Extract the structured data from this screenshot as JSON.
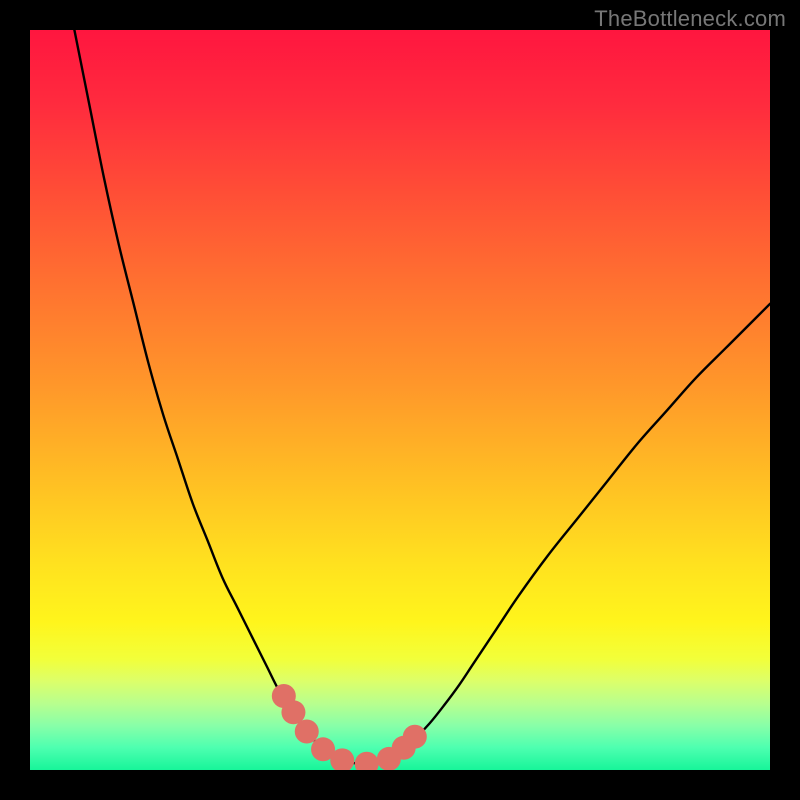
{
  "watermark": "TheBottleneck.com",
  "chart_data": {
    "type": "line",
    "title": "",
    "xlabel": "",
    "ylabel": "",
    "xlim": [
      0,
      100
    ],
    "ylim": [
      0,
      100
    ],
    "series": [
      {
        "name": "left-curve",
        "x": [
          6,
          8,
          10,
          12,
          14,
          16,
          18,
          20,
          22,
          24,
          26,
          28,
          30,
          32,
          33.5,
          35,
          36.5,
          38,
          40,
          43
        ],
        "values": [
          100,
          90,
          80,
          71,
          63,
          55,
          48,
          42,
          36,
          31,
          26,
          22,
          18,
          14,
          11,
          8.5,
          6.3,
          4.5,
          2.5,
          1.1
        ]
      },
      {
        "name": "right-curve",
        "x": [
          48,
          50,
          52,
          54,
          56,
          58,
          60,
          63,
          66,
          70,
          74,
          78,
          82,
          86,
          90,
          94,
          98,
          100
        ],
        "values": [
          1.2,
          2.5,
          4.2,
          6.3,
          8.8,
          11.5,
          14.5,
          19,
          23.5,
          29,
          34,
          39,
          44,
          48.5,
          53,
          57,
          61,
          63
        ]
      },
      {
        "name": "bottom-flat",
        "x": [
          43,
          44,
          45,
          46,
          47,
          48
        ],
        "values": [
          1.1,
          0.9,
          0.85,
          0.85,
          0.9,
          1.2
        ]
      }
    ],
    "markers": [
      {
        "x": 34.3,
        "y": 10.0
      },
      {
        "x": 35.6,
        "y": 7.8
      },
      {
        "x": 37.4,
        "y": 5.2
      },
      {
        "x": 39.6,
        "y": 2.8
      },
      {
        "x": 42.2,
        "y": 1.3
      },
      {
        "x": 45.5,
        "y": 0.85
      },
      {
        "x": 48.5,
        "y": 1.5
      },
      {
        "x": 50.5,
        "y": 3.0
      },
      {
        "x": 52.0,
        "y": 4.5
      }
    ],
    "gradient_stops": [
      {
        "offset": 0.0,
        "color": "#ff163f"
      },
      {
        "offset": 0.1,
        "color": "#ff2b3e"
      },
      {
        "offset": 0.22,
        "color": "#ff4e36"
      },
      {
        "offset": 0.35,
        "color": "#ff7330"
      },
      {
        "offset": 0.48,
        "color": "#ff972a"
      },
      {
        "offset": 0.6,
        "color": "#ffbc24"
      },
      {
        "offset": 0.72,
        "color": "#ffe11f"
      },
      {
        "offset": 0.8,
        "color": "#fff51c"
      },
      {
        "offset": 0.85,
        "color": "#f2ff3a"
      },
      {
        "offset": 0.88,
        "color": "#dcff6a"
      },
      {
        "offset": 0.91,
        "color": "#b8ff8e"
      },
      {
        "offset": 0.94,
        "color": "#88ffa8"
      },
      {
        "offset": 0.97,
        "color": "#4dffb0"
      },
      {
        "offset": 1.0,
        "color": "#17f59a"
      }
    ],
    "marker_color": "#e07066"
  }
}
